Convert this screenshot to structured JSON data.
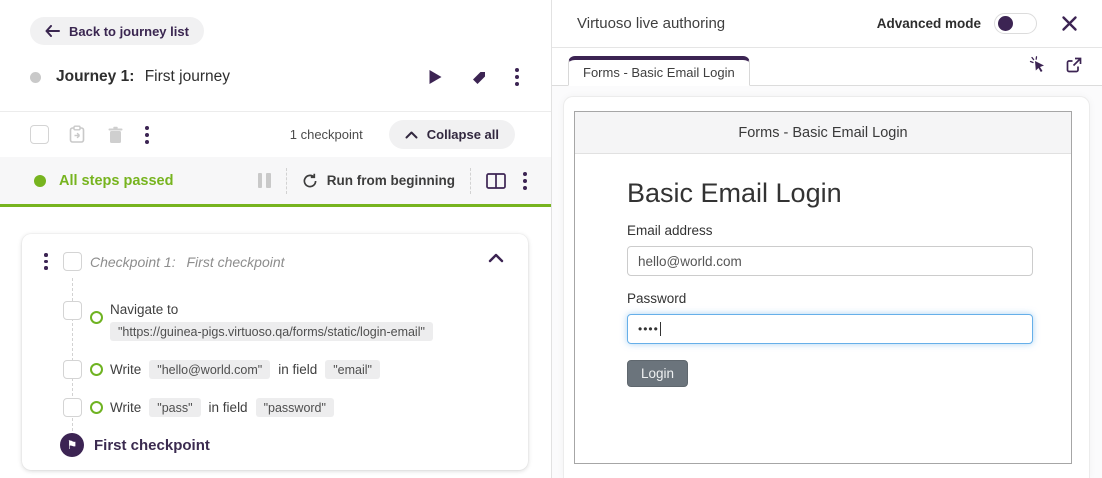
{
  "icons": {
    "flag_glyph": "⚑"
  },
  "colors": {
    "brand_purple": "#3c2453",
    "success_green": "#77b41f",
    "focus_blue": "#66afe9"
  },
  "left": {
    "back_label": "Back to journey list",
    "journey_label": "Journey 1:",
    "journey_name": "First journey",
    "checkpoint_count": "1 checkpoint",
    "collapse_all_label": "Collapse all",
    "status_text": "All steps passed",
    "run_label": "Run from beginning",
    "checkpoint": {
      "title_label": "Checkpoint 1:",
      "title_name": "First checkpoint",
      "steps": [
        {
          "action": "Navigate to",
          "target": "\"https://guinea-pigs.virtuoso.qa/forms/static/login-email\""
        },
        {
          "action": "Write",
          "value": "\"hello@world.com\"",
          "connector": "in field",
          "field": "\"email\""
        },
        {
          "action": "Write",
          "value": "\"pass\"",
          "connector": "in field",
          "field": "\"password\""
        }
      ],
      "flag_label": "First checkpoint"
    }
  },
  "right": {
    "title": "Virtuoso live authoring",
    "advanced_mode_label": "Advanced mode",
    "tab_label": "Forms - Basic Email Login",
    "preview": {
      "page_title": "Forms - Basic Email Login",
      "heading": "Basic Email Login",
      "email_label": "Email address",
      "email_value": "hello@world.com",
      "password_label": "Password",
      "password_value": "••••",
      "login_label": "Login"
    }
  }
}
